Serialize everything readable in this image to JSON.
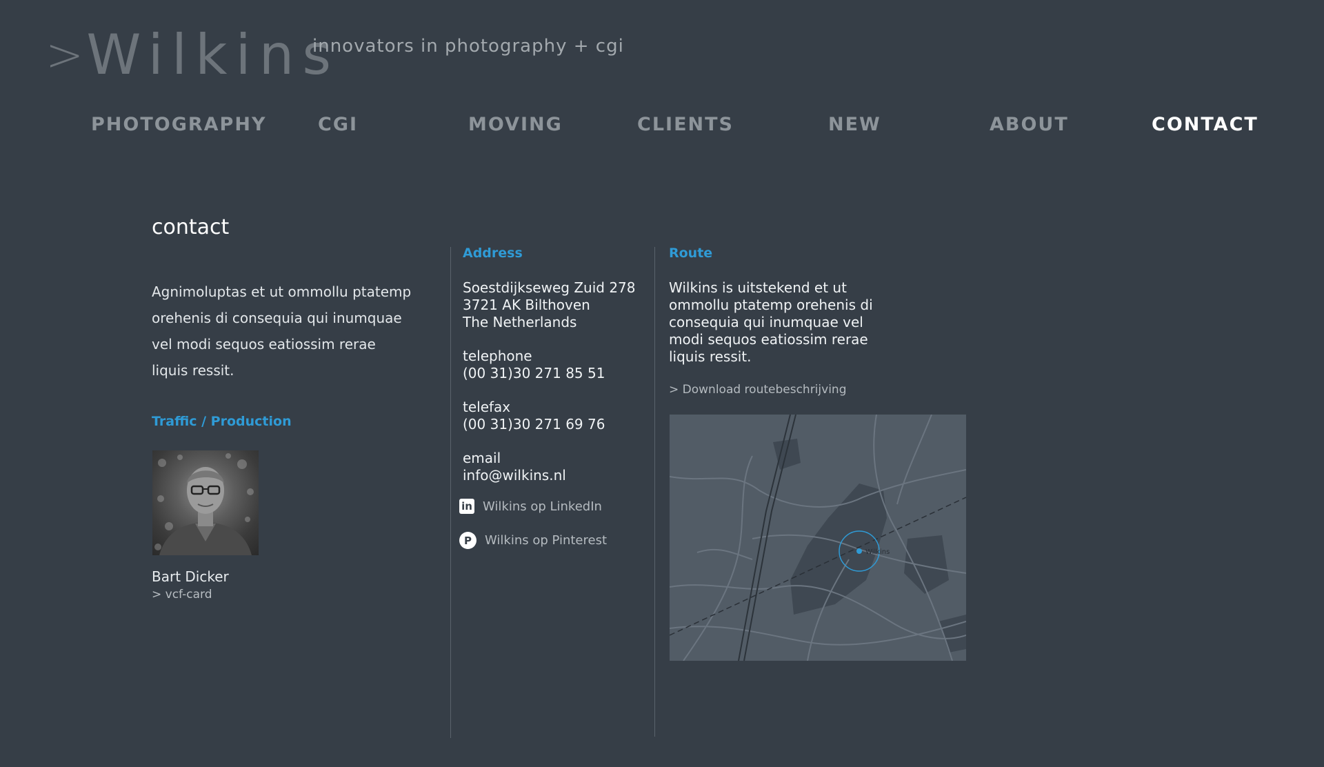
{
  "header": {
    "logo_arrow": ">",
    "logo_text": "Wilkins",
    "tagline": "innovators in photography + cgi"
  },
  "nav": {
    "items": [
      {
        "label": "PHOTOGRAPHY"
      },
      {
        "label": "CGI"
      },
      {
        "label": "MOVING"
      },
      {
        "label": "CLIENTS"
      },
      {
        "label": "NEW"
      },
      {
        "label": "ABOUT"
      },
      {
        "label": "CONTACT"
      }
    ],
    "active": "CONTACT"
  },
  "contact": {
    "heading": "contact",
    "intro": "Agnimoluptas et ut ommollu ptatemp orehenis di consequia qui inumquae vel modi sequos eatiossim rerae liquis ressit.",
    "traffic_label": "Traffic / Production",
    "person_name": "Bart Dicker",
    "vcf_label": "> vcf-card"
  },
  "address": {
    "label": "Address",
    "street": "Soestdijkseweg Zuid 278",
    "city": "3721 AK Bilthoven",
    "country": "The Netherlands",
    "telephone_label": "telephone",
    "telephone": "(00 31)30 271 85 51",
    "telefax_label": "telefax",
    "telefax": "(00 31)30 271 69 76",
    "email_label": "email",
    "email": "info@wilkins.nl",
    "linkedin": "Wilkins op LinkedIn",
    "pinterest": "Wilkins op Pinterest",
    "linkedin_icon": "linkedin-icon",
    "pinterest_icon": "pinterest-icon"
  },
  "route": {
    "label": "Route",
    "text": "Wilkins is uitstekend et ut ommollu ptatemp orehenis di consequia qui inumquae vel modi sequos eatiossim rerae liquis ressit.",
    "download": "> Download routebeschrijving",
    "map_marker_label": "Wilkins"
  },
  "colors": {
    "background": "#363e47",
    "accent": "#2f9bd6",
    "nav_inactive": "#8d949a",
    "nav_active": "#ffffff",
    "logo": "#6d747b"
  }
}
